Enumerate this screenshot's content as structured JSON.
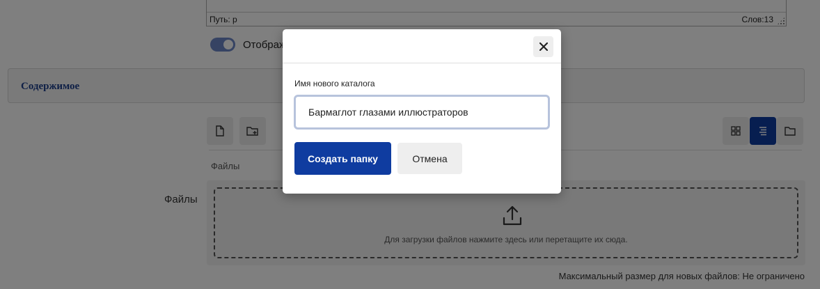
{
  "editor": {
    "path_label": "Путь: p",
    "word_count": "Слов:13"
  },
  "display_toggle": {
    "label": "Отображ",
    "on": true
  },
  "section": {
    "title": "Содержимое"
  },
  "toolbar": {
    "buttons": [
      {
        "icon": "file-icon"
      },
      {
        "icon": "folder-add-icon"
      },
      {
        "icon": "grid-view-icon"
      },
      {
        "icon": "list-view-icon",
        "active": true
      },
      {
        "icon": "folder-icon"
      }
    ]
  },
  "files": {
    "small_label": "Файлы",
    "field_label": "Файлы",
    "dropzone_text": "Для загрузки файлов нажмите здесь или перетащите их сюда.",
    "max_size_text": "Максимальный размер для новых файлов: Не ограничено"
  },
  "modal": {
    "field_label": "Имя нового каталога",
    "input_value": "Бармаглот глазами иллюстраторов",
    "create_label": "Создать папку",
    "cancel_label": "Отмена"
  },
  "colors": {
    "accent": "#0f3ca0",
    "toggle": "#6d87c7",
    "section_title": "#1d3f8c"
  }
}
